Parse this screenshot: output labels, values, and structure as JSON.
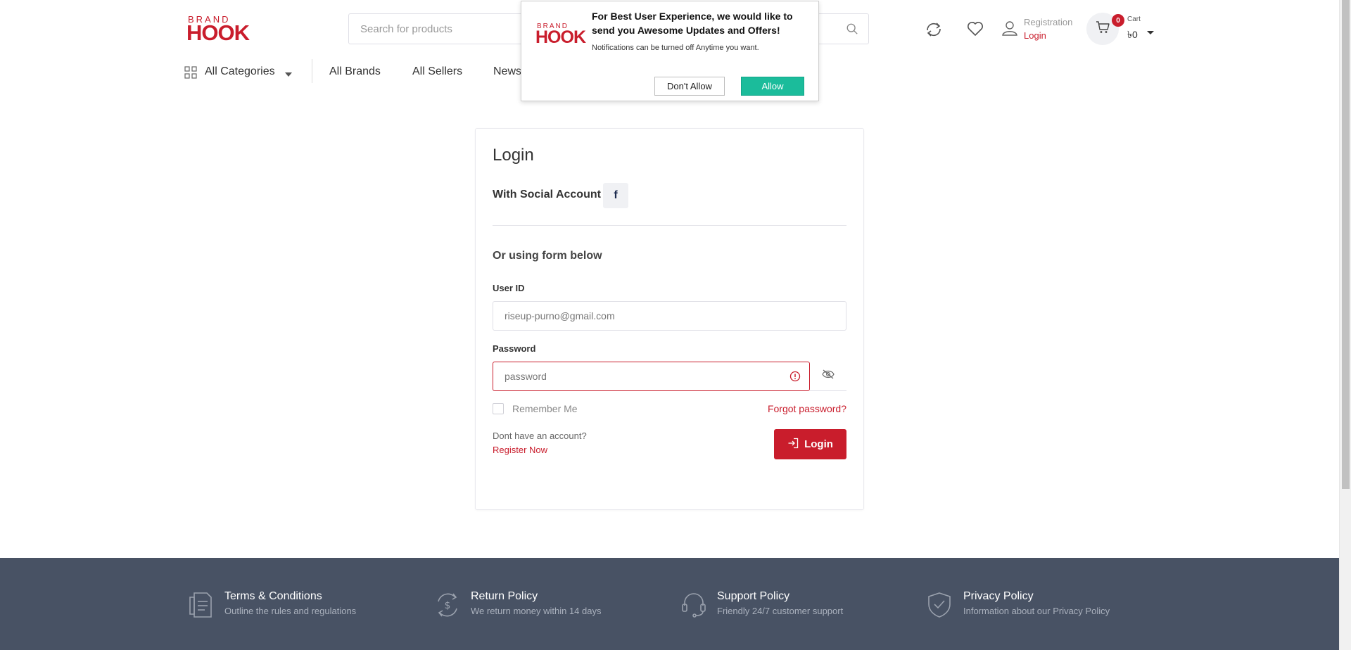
{
  "header": {
    "logo": {
      "brand": "BRAND",
      "hook": "HOOK"
    },
    "search_placeholder": "Search for products",
    "account": {
      "registration": "Registration",
      "login": "Login"
    },
    "cart": {
      "count": "0",
      "label": "Cart",
      "amount": "৳0"
    }
  },
  "nav": {
    "categories": "All Categories",
    "links": [
      "All Brands",
      "All Sellers",
      "News"
    ]
  },
  "notification": {
    "title": "For Best User Experience, we would like to send you Awesome Updates and Offers!",
    "body": "Notifications can be turned off Anytime you want.",
    "deny": "Don't Allow",
    "allow": "Allow"
  },
  "login_card": {
    "title": "Login",
    "social_label": "With Social Account",
    "facebook": "f",
    "or_label": "Or using form below",
    "userid_label": "User ID",
    "userid_placeholder": "riseup-purno@gmail.com",
    "password_label": "Password",
    "password_placeholder": "password",
    "remember": "Remember Me",
    "forgot": "Forgot password?",
    "no_account": "Dont have an account?",
    "register": "Register Now",
    "login_button": "Login"
  },
  "footer": {
    "items": [
      {
        "title": "Terms & Conditions",
        "subtitle": "Outline the rules and regulations",
        "icon": "document-icon"
      },
      {
        "title": "Return Policy",
        "subtitle": "We return money within 14 days",
        "icon": "money-return-icon"
      },
      {
        "title": "Support Policy",
        "subtitle": "Friendly 24/7 customer support",
        "icon": "headset-icon"
      },
      {
        "title": "Privacy Policy",
        "subtitle": "Information about our Privacy Policy",
        "icon": "shield-check-icon"
      }
    ]
  },
  "colors": {
    "brand": "#c91d2c",
    "allow": "#1bbc9b",
    "footer": "#485264"
  }
}
